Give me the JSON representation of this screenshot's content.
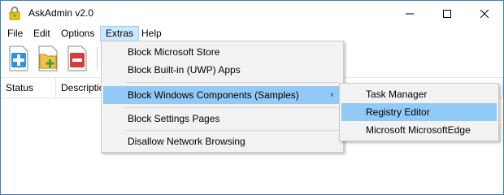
{
  "window": {
    "title": "AskAdmin v2.0"
  },
  "menubar": {
    "items": [
      "File",
      "Edit",
      "Options",
      "Extras",
      "Help"
    ]
  },
  "list": {
    "columns": [
      "Status",
      "Description"
    ]
  },
  "extras_menu": {
    "items": [
      "Block Microsoft Store",
      "Block Built-in (UWP) Apps",
      "Block Windows Components (Samples)",
      "Block Settings Pages",
      "Disallow Network Browsing"
    ],
    "submenu_arrow": "›"
  },
  "submenu": {
    "items": [
      "Task Manager",
      "Registry Editor",
      "Microsoft MicrosoftEdge"
    ]
  },
  "colors": {
    "menu_highlight": "#91c9f7",
    "menubar_active": "#cce8ff",
    "window_border": "#3c7fb1",
    "popup_bg": "#f2f2f2"
  },
  "icons": [
    "lock-app-icon",
    "minimize-icon",
    "maximize-icon",
    "close-icon",
    "add-icon",
    "add-folder-icon",
    "remove-icon"
  ]
}
